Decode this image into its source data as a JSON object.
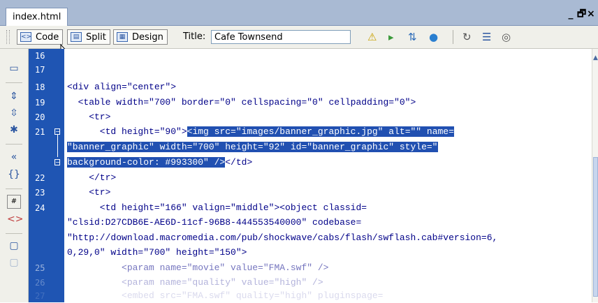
{
  "document_tab": {
    "label": "index.html"
  },
  "window_controls": {
    "minimize": "_",
    "restore": "🗗",
    "close": "×"
  },
  "toolbar": {
    "code_label": "Code",
    "split_label": "Split",
    "design_label": "Design",
    "title_label": "Title:",
    "title_value": "Cafe Townsend",
    "icons": [
      "no-browser-check-errors-icon",
      "file-management-icon",
      "validate-markup-icon",
      "preview-in-browser-icon",
      "refresh-icon",
      "view-options-icon",
      "visual-aids-icon"
    ]
  },
  "sidebar": {
    "icons": [
      "open-documents-icon",
      "collapse-full-tag-icon",
      "collapse-selection-icon",
      "expand-all-icon",
      "select-parent-tag-icon",
      "balance-braces-icon",
      "line-numbers-icon",
      "highlight-invalid-code-icon",
      "apply-comment-icon",
      "remove-comment-icon"
    ]
  },
  "code": {
    "lines": [
      {
        "num": "16",
        "marker": "",
        "text": ""
      },
      {
        "num": "17",
        "marker": "",
        "text": ""
      },
      {
        "num": "18",
        "marker": "",
        "text": "<div align=\"center\">"
      },
      {
        "num": "19",
        "marker": "",
        "text": "  <table width=\"700\" border=\"0\" cellspacing=\"0\" cellpadding=\"0\">"
      },
      {
        "num": "20",
        "marker": "",
        "text": "    <tr>"
      },
      {
        "num": "21",
        "marker": "collapse",
        "text": "      <td height=\"90\">",
        "selected": "<img src=\"images/banner_graphic.jpg\" alt=\"\" name="
      },
      {
        "num": "",
        "marker": "",
        "selected": "\"banner_graphic\" width=\"700\" height=\"92\" id=\"banner_graphic\" style=\""
      },
      {
        "num": "",
        "marker": "collapse",
        "selected": "background-color: #993300\" />",
        "text": "</td>"
      },
      {
        "num": "22",
        "marker": "",
        "text": "    </tr>"
      },
      {
        "num": "23",
        "marker": "",
        "text": "    <tr>"
      },
      {
        "num": "24",
        "marker": "",
        "text": "      <td height=\"166\" valign=\"middle\"><object classid="
      },
      {
        "num": "",
        "marker": "",
        "text": "\"clsid:D27CDB6E-AE6D-11cf-96B8-444553540000\" codebase="
      },
      {
        "num": "",
        "marker": "",
        "text": "\"http://download.macromedia.com/pub/shockwave/cabs/flash/swflash.cab#version=6,"
      },
      {
        "num": "",
        "marker": "",
        "text": "0,29,0\" width=\"700\" height=\"150\">"
      },
      {
        "num": "25",
        "marker": "",
        "text": "          <param name=\"movie\" value=\"FMA.swf\" />"
      },
      {
        "num": "26",
        "marker": "",
        "text": "          <param name=\"quality\" value=\"high\" />"
      },
      {
        "num": "27",
        "marker": "",
        "text": "          <embed src=\"FMA.swf\" quality=\"high\" pluginspage="
      }
    ]
  }
}
